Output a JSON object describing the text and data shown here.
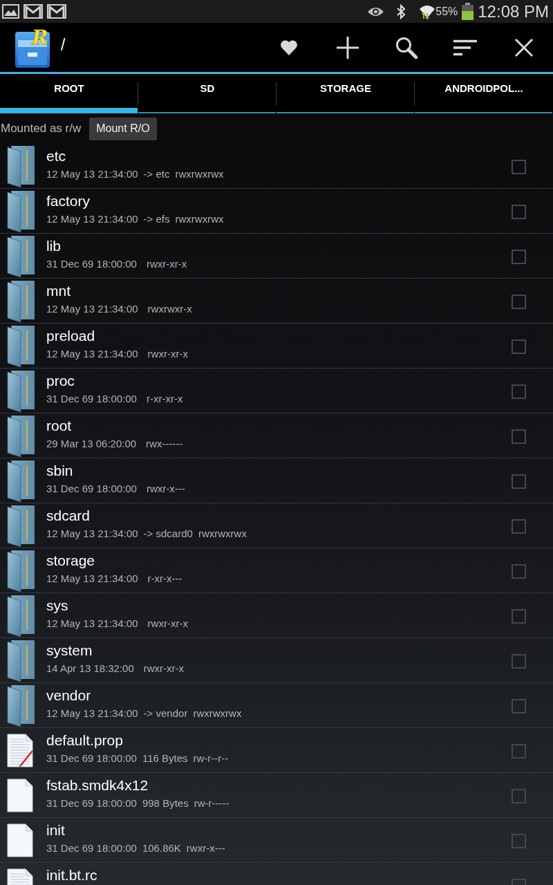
{
  "status_bar": {
    "battery_percent": "55%",
    "time": "12:08 PM"
  },
  "action_bar": {
    "logo_letter": "R",
    "path": "/"
  },
  "tabs": [
    {
      "label": "ROOT",
      "selected": true
    },
    {
      "label": "SD",
      "selected": false
    },
    {
      "label": "STORAGE",
      "selected": false
    },
    {
      "label": "ANDROIDPOL...",
      "selected": false
    }
  ],
  "mount": {
    "status": "Mounted as r/w",
    "button": "Mount R/O"
  },
  "files": [
    {
      "kind": "folder",
      "name": "etc",
      "date": "12 May 13 21:34:00",
      "detail": "-> etc",
      "permissions": "rwxrwxrwx",
      "checked": false
    },
    {
      "kind": "folder",
      "name": "factory",
      "date": "12 May 13 21:34:00",
      "detail": "-> efs",
      "permissions": "rwxrwxrwx",
      "checked": false
    },
    {
      "kind": "folder",
      "name": "lib",
      "date": "31 Dec 69 18:00:00",
      "permissions": "rwxr-xr-x",
      "checked": false
    },
    {
      "kind": "folder",
      "name": "mnt",
      "date": "12 May 13 21:34:00",
      "permissions": "rwxrwxr-x",
      "checked": false
    },
    {
      "kind": "folder",
      "name": "preload",
      "date": "12 May 13 21:34:00",
      "permissions": "rwxr-xr-x",
      "checked": false
    },
    {
      "kind": "folder",
      "name": "proc",
      "date": "31 Dec 69 18:00:00",
      "permissions": "r-xr-xr-x",
      "checked": false
    },
    {
      "kind": "folder",
      "name": "root",
      "date": "29 Mar 13 06:20:00",
      "permissions": "rwx------",
      "checked": false
    },
    {
      "kind": "folder",
      "name": "sbin",
      "date": "31 Dec 69 18:00:00",
      "permissions": "rwxr-x---",
      "checked": false
    },
    {
      "kind": "folder",
      "name": "sdcard",
      "date": "12 May 13 21:34:00",
      "detail": "-> sdcard0",
      "permissions": "rwxrwxrwx",
      "checked": false
    },
    {
      "kind": "folder",
      "name": "storage",
      "date": "12 May 13 21:34:00",
      "permissions": "r-xr-x---",
      "checked": false
    },
    {
      "kind": "folder",
      "name": "sys",
      "date": "12 May 13 21:34:00",
      "permissions": "rwxr-xr-x",
      "checked": false
    },
    {
      "kind": "folder",
      "name": "system",
      "date": "14 Apr 13 18:32:00",
      "permissions": "rwxr-xr-x",
      "checked": false
    },
    {
      "kind": "folder",
      "name": "vendor",
      "date": "12 May 13 21:34:00",
      "detail": "-> vendor",
      "permissions": "rwxrwxrwx",
      "checked": false
    },
    {
      "kind": "edited",
      "name": "default.prop",
      "date": "31 Dec 69 18:00:00",
      "detail": "116 Bytes",
      "permissions": "rw-r--r--",
      "checked": false
    },
    {
      "kind": "blank",
      "name": "fstab.smdk4x12",
      "date": "31 Dec 69 18:00:00",
      "detail": "998 Bytes",
      "permissions": "rw-r-----",
      "checked": false
    },
    {
      "kind": "blank",
      "name": "init",
      "date": "31 Dec 69 18:00:00",
      "detail": "106.86K",
      "permissions": "rwxr-x---",
      "checked": false
    },
    {
      "kind": "text",
      "name": "init.bt.rc",
      "checked": false
    }
  ]
}
